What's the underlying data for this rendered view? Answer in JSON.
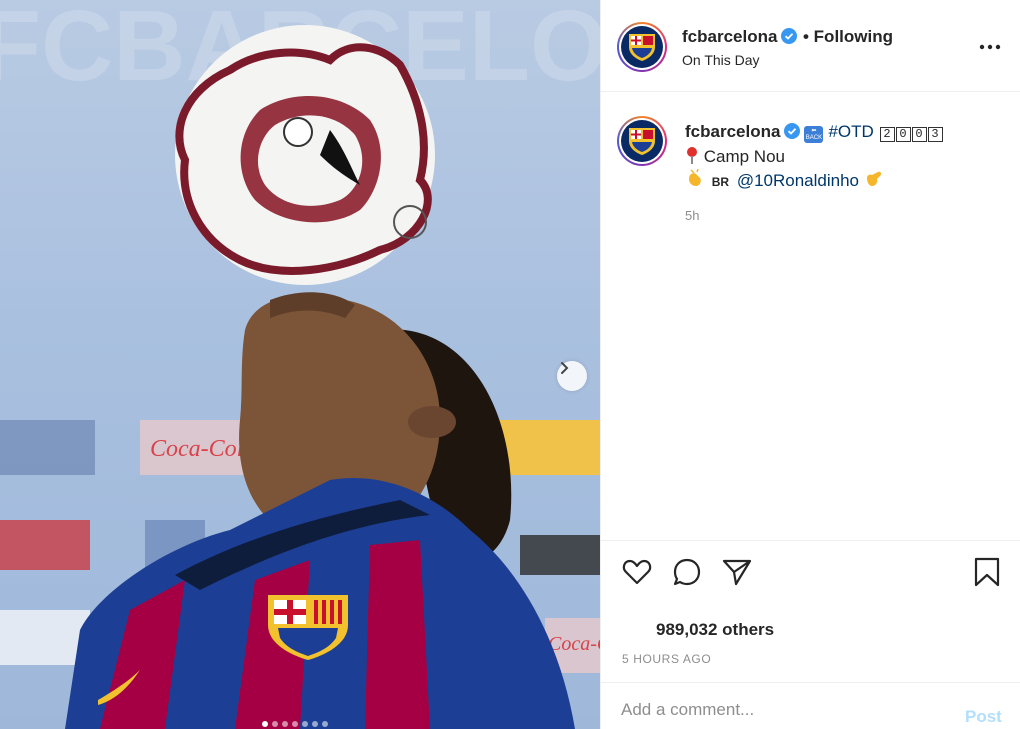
{
  "post": {
    "username": "fcbarcelona",
    "follow_status": "• Following",
    "location": "On This Day",
    "more_label": "...",
    "caption": {
      "hashtag": "#OTD",
      "year_digits": [
        "2",
        "0",
        "0",
        "3"
      ],
      "back_badge": "BACK",
      "place": "Camp Nou",
      "flag_code": "BR",
      "mention": "@10Ronaldinho",
      "time": "5h"
    },
    "likes": "989,032 others",
    "timestamp": "5 HOURS AGO",
    "comment_placeholder": "Add a comment...",
    "post_button": "Post"
  },
  "media": {
    "slide_count": 7,
    "active_slide": 0,
    "background_text": "FCBARCELONA",
    "sponsor_texts": [
      "Coca-Cola",
      "Coca-Cola"
    ]
  },
  "colors": {
    "verified_blue": "#3897f0",
    "link_blue": "#00376b",
    "muted_gray": "#8e8e8e",
    "post_button_blue": "#b2dffc",
    "barca_blue": "#1c3f95",
    "barca_red": "#a50044"
  },
  "icons": [
    "heart-icon",
    "comment-icon",
    "share-icon",
    "bookmark-icon",
    "more-icon",
    "chevron-right-icon",
    "verified-icon"
  ]
}
